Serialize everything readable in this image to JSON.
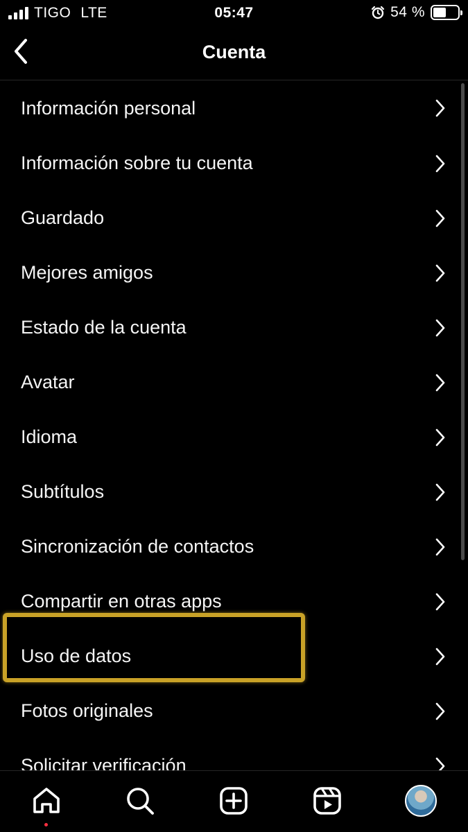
{
  "status_bar": {
    "carrier": "TIGO",
    "network": "LTE",
    "time": "05:47",
    "battery": "54 %",
    "battery_level": 0.54
  },
  "header": {
    "title": "Cuenta"
  },
  "menu": {
    "items": [
      {
        "label": "Información personal"
      },
      {
        "label": "Información sobre tu cuenta"
      },
      {
        "label": "Guardado"
      },
      {
        "label": "Mejores amigos"
      },
      {
        "label": "Estado de la cuenta"
      },
      {
        "label": "Avatar"
      },
      {
        "label": "Idioma"
      },
      {
        "label": "Subtítulos"
      },
      {
        "label": "Sincronización de contactos"
      },
      {
        "label": "Compartir en otras apps"
      },
      {
        "label": "Uso de datos"
      },
      {
        "label": "Fotos originales"
      },
      {
        "label": "Solicitar verificación"
      }
    ]
  },
  "colors": {
    "background": "#000000",
    "highlight": "#c9a227",
    "notification_dot": "#ff3040"
  },
  "tabbar": {
    "icons": [
      "home-icon",
      "search-icon",
      "create-icon",
      "reels-icon",
      "profile-avatar"
    ]
  }
}
